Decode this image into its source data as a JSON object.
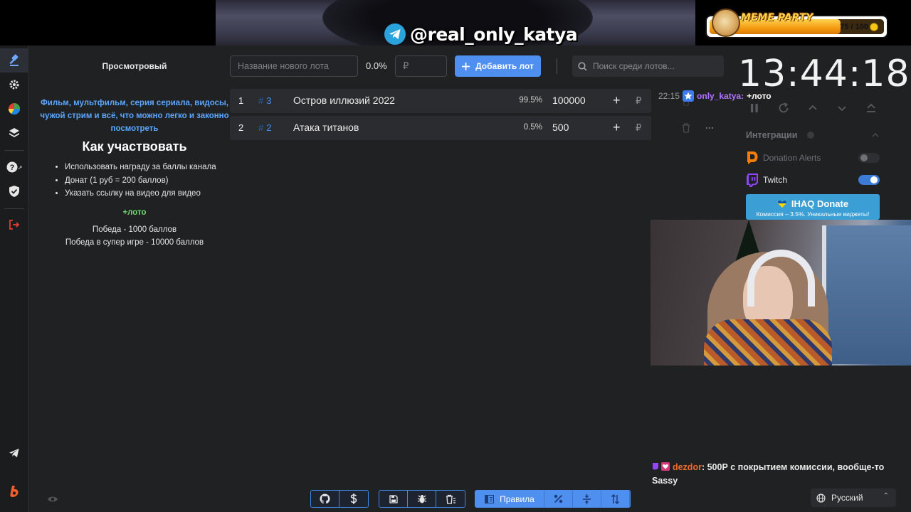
{
  "overlay": {
    "telegram_handle": "@real_only_katya",
    "meme_party": {
      "title": "MEME PARTY",
      "count": "75 / 100",
      "progress": 0.75
    }
  },
  "colors": {
    "accent": "#4e8ff0",
    "link_blue": "#5ba6ff",
    "green": "#6bd86b",
    "chat_user": "#b073ff",
    "chat_user2": "#f26a2a",
    "twitch_purple": "#9146ff",
    "da_orange": "#f57d07"
  },
  "sidebar": {
    "items": [
      {
        "icon": "gavel-icon",
        "active": true
      },
      {
        "icon": "gear-icon"
      },
      {
        "icon": "pie-chart-icon"
      },
      {
        "icon": "layers-icon"
      },
      {
        "icon": "help-icon"
      },
      {
        "icon": "shield-icon"
      },
      {
        "icon": "logout-icon"
      },
      {
        "icon": "telegram-icon"
      },
      {
        "icon": "boosty-icon"
      }
    ]
  },
  "rules": {
    "title": "Просмотровый",
    "description": "Фильм, мультфильм, серия сериала, видосы, чужой стрим и всё, что можно легко и законно посмотреть",
    "heading": "Как участвовать",
    "items": [
      "Использовать награду за баллы канала",
      "Донат (1 руб = 200 баллов)",
      "Указать ссылку на видео для видео"
    ],
    "lot_command": "+лото",
    "win": "Победа - 1000 баллов",
    "win_super": "Победа в супер игре - 10000 баллов"
  },
  "toolbar": {
    "lot_name_placeholder": "Название нового лота",
    "percent": "0.0%",
    "amount_placeholder": "₽",
    "add_label": "Добавить лот",
    "search_placeholder": "Поиск среди лотов..."
  },
  "lots": [
    {
      "index": "1",
      "tag_hash": "#",
      "tag": "3",
      "name": "Остров иллюзий 2022",
      "percent": "99.5%",
      "amount": "100000",
      "plus": "+",
      "currency": "₽"
    },
    {
      "index": "2",
      "tag_hash": "#",
      "tag": "2",
      "name": "Атака титанов",
      "percent": "0.5%",
      "amount": "500",
      "plus": "+",
      "currency": "₽"
    }
  ],
  "timer": {
    "value": "13:44:18"
  },
  "chat_top": {
    "time": "22:15",
    "user": "only_katya:",
    "message": "+лото"
  },
  "integrations": {
    "title": "Интеграции",
    "items": [
      {
        "name": "Donation Alerts",
        "enabled": false
      },
      {
        "name": "Twitch",
        "enabled": true
      }
    ],
    "ihaq": {
      "title": "IHAQ Donate",
      "subtitle": "Комиссия – 3.5%. Уникальные виджеты!"
    }
  },
  "chat_bottom": {
    "user": "dezdor",
    "message": ": 500Р с покрытием комиссии, вообще-то",
    "line2": "Sassy"
  },
  "language": {
    "selected": "Русский"
  },
  "bottom_bar": {
    "rules_label": "Правила"
  }
}
